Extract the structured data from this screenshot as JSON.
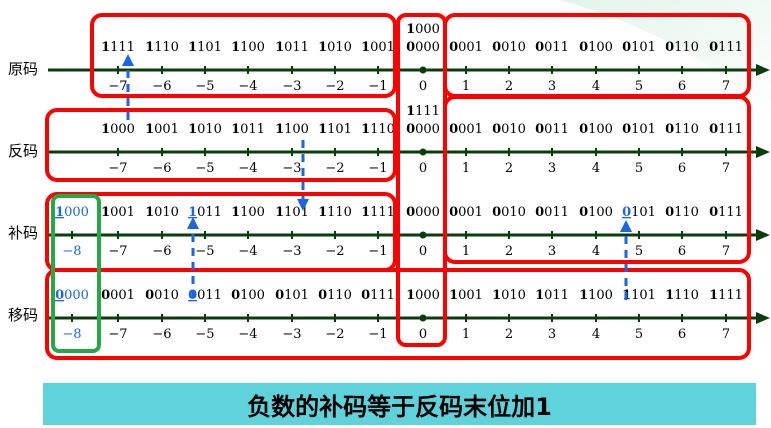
{
  "rows": [
    {
      "label": "原码",
      "codes": [
        "1111",
        "1110",
        "1101",
        "1100",
        "1011",
        "1010",
        "1001",
        "1000\n0000",
        "0001",
        "0010",
        "0011",
        "0100",
        "0101",
        "0110",
        "0111"
      ],
      "ticks": [
        "−7",
        "−6",
        "−5",
        "−4",
        "−3",
        "−2",
        "−1",
        "0",
        "1",
        "2",
        "3",
        "4",
        "5",
        "6",
        "7"
      ]
    },
    {
      "label": "反码",
      "codes": [
        "1000",
        "1001",
        "1010",
        "1011",
        "1100",
        "1101",
        "1110",
        "1111\n0000",
        "0001",
        "0010",
        "0011",
        "0100",
        "0101",
        "0110",
        "0111"
      ],
      "ticks": [
        "−7",
        "−6",
        "−5",
        "−4",
        "−3",
        "−2",
        "−1",
        "0",
        "1",
        "2",
        "3",
        "4",
        "5",
        "6",
        "7"
      ]
    },
    {
      "label": "补码",
      "codes": [
        "1000",
        "1001",
        "1010",
        "1011",
        "1100",
        "1101",
        "1110",
        "1111",
        "0000",
        "0001",
        "0010",
        "0011",
        "0100",
        "0101",
        "0110",
        "0111"
      ],
      "ticks": [
        "−8",
        "−7",
        "−6",
        "−5",
        "−4",
        "−3",
        "−2",
        "−1",
        "0",
        "1",
        "2",
        "3",
        "4",
        "5",
        "6",
        "7"
      ]
    },
    {
      "label": "移码",
      "codes": [
        "0000",
        "0001",
        "0010",
        "0011",
        "0100",
        "0101",
        "0110",
        "0111",
        "1000",
        "1001",
        "1010",
        "1011",
        "1100",
        "1101",
        "1110",
        "1111"
      ],
      "ticks": [
        "−8",
        "−7",
        "−6",
        "−5",
        "−4",
        "−3",
        "−2",
        "−1",
        "0",
        "1",
        "2",
        "3",
        "4",
        "5",
        "6",
        "7"
      ]
    }
  ],
  "banner": "负数的补码等于反码末位加1",
  "colors": {
    "axis": "#0b3d0b",
    "box": "#ff0000",
    "highlight_box": "#22aa44",
    "arrow": "#1a66e6",
    "blue_text": "#1a66e6",
    "banner_bg": "#5fd3dc"
  }
}
